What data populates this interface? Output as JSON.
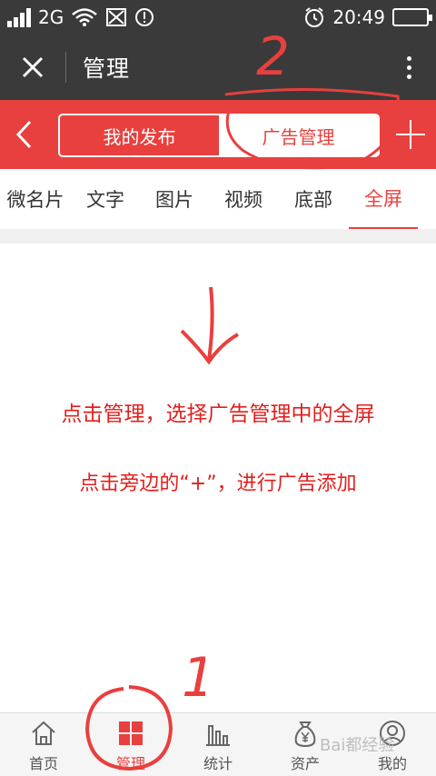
{
  "status_bar": {
    "network": "2G",
    "time": "20:49"
  },
  "title_bar": {
    "title": "管理"
  },
  "header": {
    "segments": [
      {
        "label": "我的发布",
        "active": false
      },
      {
        "label": "广告管理",
        "active": true
      }
    ]
  },
  "category_tabs": [
    {
      "label": "微名片",
      "active": false
    },
    {
      "label": "文字",
      "active": false
    },
    {
      "label": "图片",
      "active": false
    },
    {
      "label": "视频",
      "active": false
    },
    {
      "label": "底部",
      "active": false
    },
    {
      "label": "全屏",
      "active": true
    }
  ],
  "annotations": {
    "number_top": "2",
    "number_bottom": "1",
    "instruction_line1": "点击管理，选择广告管理中的全屏",
    "instruction_line2": "点击旁边的“+”，进行广告添加"
  },
  "bottom_nav": [
    {
      "label": "首页",
      "icon": "home-icon",
      "active": false
    },
    {
      "label": "管理",
      "icon": "grid-icon",
      "active": true
    },
    {
      "label": "统计",
      "icon": "bar-chart-icon",
      "active": false
    },
    {
      "label": "资产",
      "icon": "money-bag-icon",
      "active": false
    },
    {
      "label": "我的",
      "icon": "user-icon",
      "active": false
    }
  ],
  "watermark": "Bai都经验",
  "colors": {
    "brand_red": "#e8403e",
    "annotation_red": "#e0201e",
    "dark_bar": "#3a3a3a"
  }
}
